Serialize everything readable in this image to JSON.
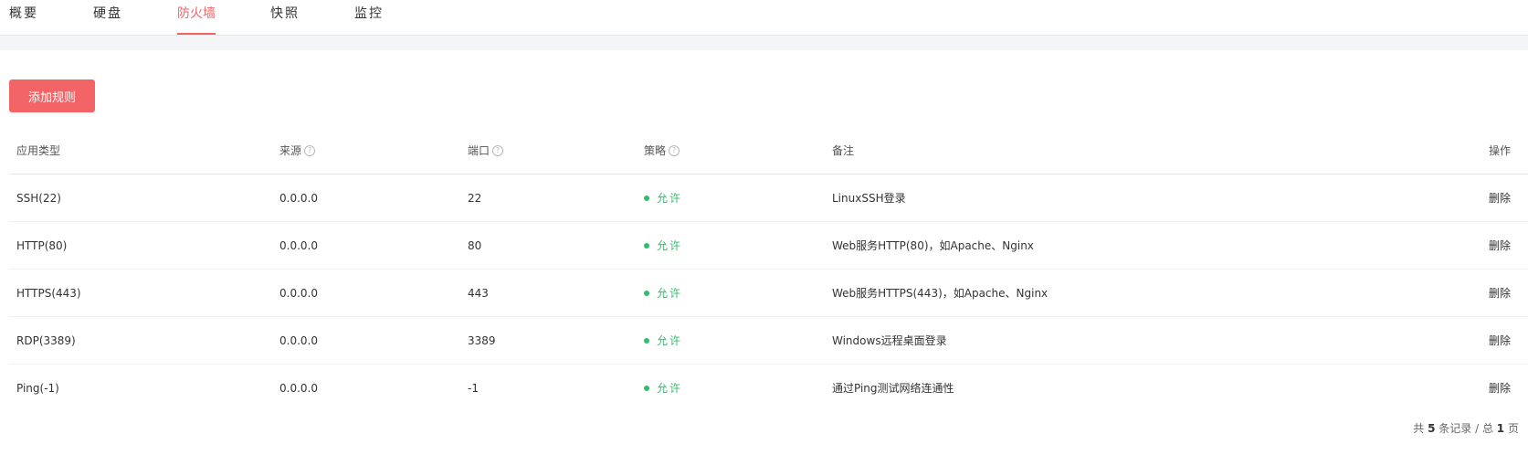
{
  "tabs": [
    {
      "label": "概要",
      "active": false
    },
    {
      "label": "硬盘",
      "active": false
    },
    {
      "label": "防火墙",
      "active": true
    },
    {
      "label": "快照",
      "active": false
    },
    {
      "label": "监控",
      "active": false
    }
  ],
  "toolbar": {
    "add_rule_label": "添加规则"
  },
  "table": {
    "headers": {
      "type": "应用类型",
      "source": "来源",
      "port": "端口",
      "policy": "策略",
      "note": "备注",
      "operation": "操作"
    },
    "help_glyph": "?",
    "rows": [
      {
        "type": "SSH(22)",
        "source": "0.0.0.0",
        "port": "22",
        "policy": "允许",
        "note": "LinuxSSH登录",
        "action": "删除"
      },
      {
        "type": "HTTP(80)",
        "source": "0.0.0.0",
        "port": "80",
        "policy": "允许",
        "note": "Web服务HTTP(80)，如Apache、Nginx",
        "action": "删除"
      },
      {
        "type": "HTTPS(443)",
        "source": "0.0.0.0",
        "port": "443",
        "policy": "允许",
        "note": "Web服务HTTPS(443)，如Apache、Nginx",
        "action": "删除"
      },
      {
        "type": "RDP(3389)",
        "source": "0.0.0.0",
        "port": "3389",
        "policy": "允许",
        "note": "Windows远程桌面登录",
        "action": "删除"
      },
      {
        "type": "Ping(-1)",
        "source": "0.0.0.0",
        "port": "-1",
        "policy": "允许",
        "note": "通过Ping测试网络连通性",
        "action": "删除"
      }
    ]
  },
  "pagination": {
    "prefix": "共",
    "total_records": "5",
    "records_suffix": "条记录 / 总",
    "total_pages": "1",
    "pages_suffix": "页"
  },
  "colors": {
    "accent": "#f36466",
    "allow": "#2dbf6d"
  }
}
